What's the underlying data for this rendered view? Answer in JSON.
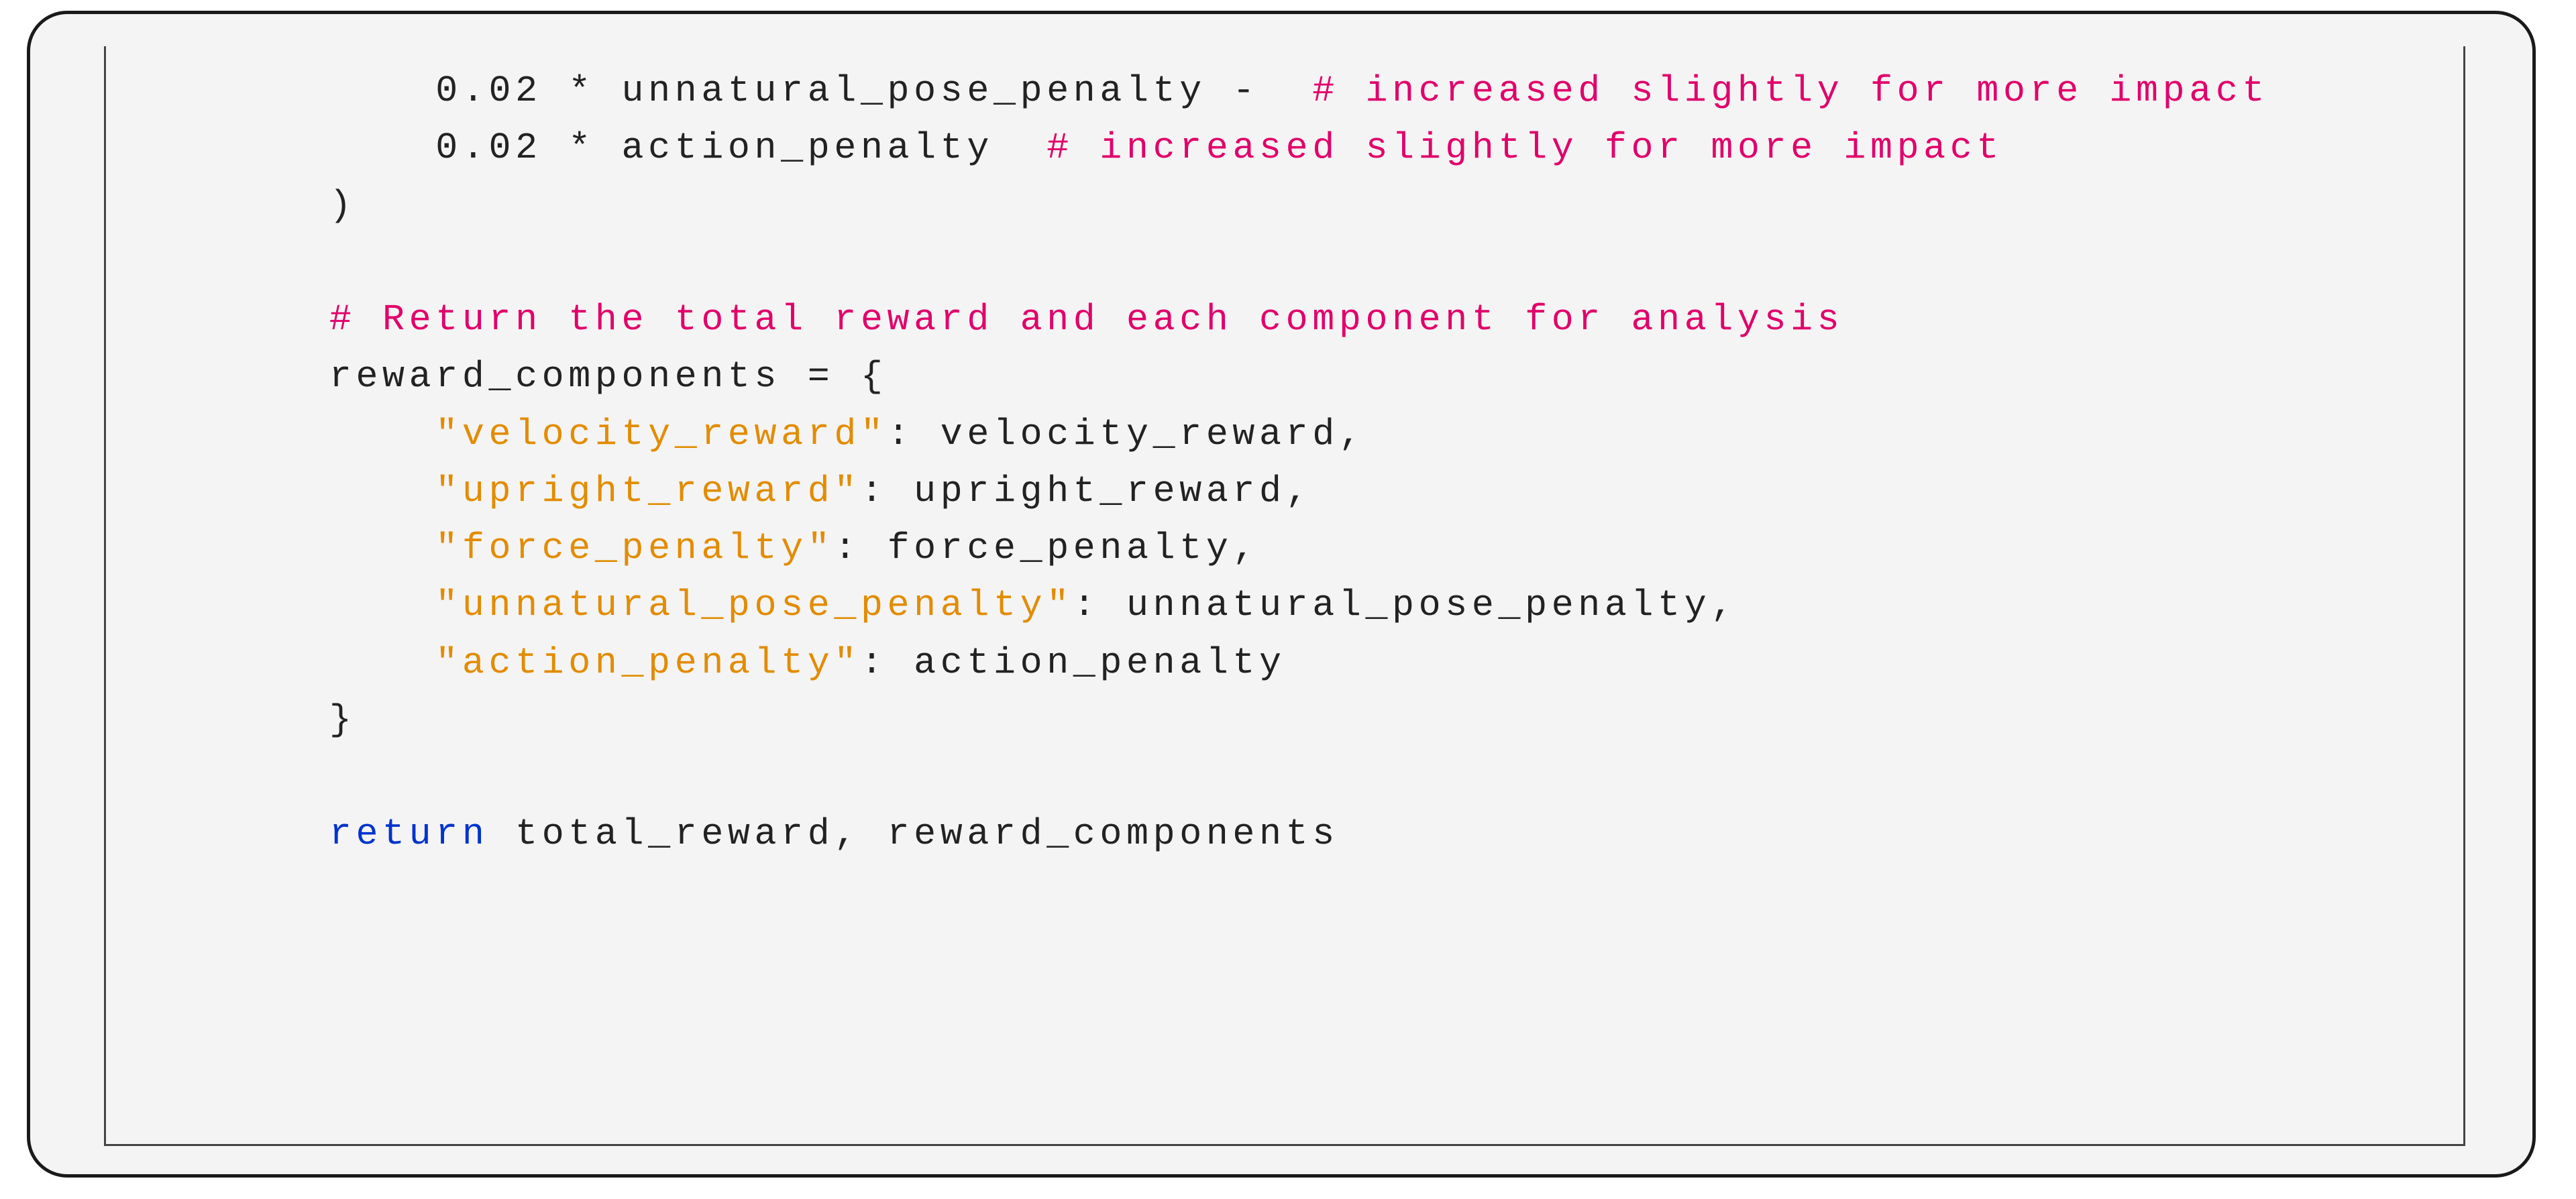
{
  "code": {
    "line1": {
      "indent": "            ",
      "num": "0.02",
      "mid": " * unnatural_pose_penalty -  ",
      "comment": "# increased slightly for more impact"
    },
    "line2": {
      "indent": "            ",
      "num": "0.02",
      "mid": " * action_penalty  ",
      "comment": "# increased slightly for more impact"
    },
    "line3": "        )",
    "line_blank1": "",
    "line4_indent": "        ",
    "line4_comment": "# Return the total reward and each component for analysis",
    "line5": "        reward_components = {",
    "kv": {
      "k1": "\"velocity_reward\"",
      "v1": ": velocity_reward,",
      "k2": "\"upright_reward\"",
      "v2": ": upright_reward,",
      "k3": "\"force_penalty\"",
      "v3": ": force_penalty,",
      "k4": "\"unnatural_pose_penalty\"",
      "v4": ": unnatural_pose_penalty,",
      "k5": "\"action_penalty\"",
      "v5": ": action_penalty"
    },
    "line_dict_indent": "            ",
    "line_close": "        }",
    "line_blank2": "",
    "ret_indent": "        ",
    "ret_keyword": "return",
    "ret_rest": " total_reward, reward_components"
  }
}
